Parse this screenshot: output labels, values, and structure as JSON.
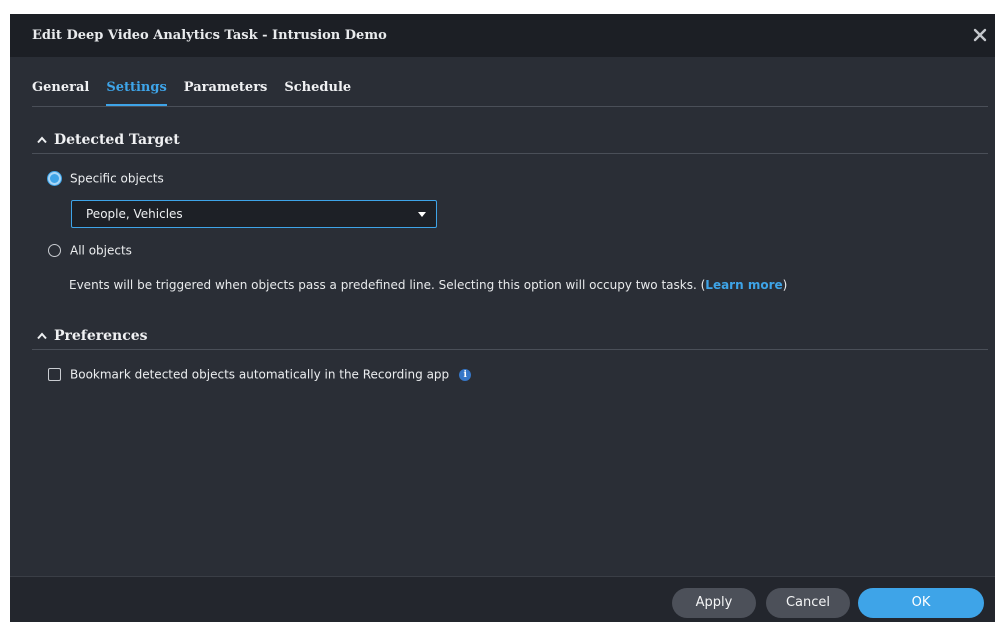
{
  "dialog": {
    "title": "Edit Deep Video Analytics Task - Intrusion Demo",
    "close_icon": "close-icon"
  },
  "tabs": [
    {
      "label": "General",
      "active": false
    },
    {
      "label": "Settings",
      "active": true
    },
    {
      "label": "Parameters",
      "active": false
    },
    {
      "label": "Schedule",
      "active": false
    }
  ],
  "detected_target": {
    "heading": "Detected Target",
    "specific_objects_label": "Specific objects",
    "specific_objects_selected": true,
    "objects_select_value": "People, Vehicles",
    "all_objects_label": "All objects",
    "all_objects_selected": false,
    "hint_text": "Events will be triggered when objects pass a predefined line. Selecting this option will occupy two tasks. (",
    "learn_more_label": "Learn more",
    "hint_close": ")"
  },
  "preferences": {
    "heading": "Preferences",
    "bookmark_label": "Bookmark detected objects automatically in the Recording app",
    "bookmark_checked": false,
    "info_icon": "info-icon",
    "info_glyph": "i"
  },
  "footer": {
    "apply_label": "Apply",
    "cancel_label": "Cancel",
    "ok_label": "OK"
  },
  "colors": {
    "accent": "#3ea4e8",
    "dialog_bg": "#2a2e36",
    "titlebar_bg": "#1c1f25",
    "footer_bg": "#23262d",
    "gray_button": "#4c5059"
  }
}
